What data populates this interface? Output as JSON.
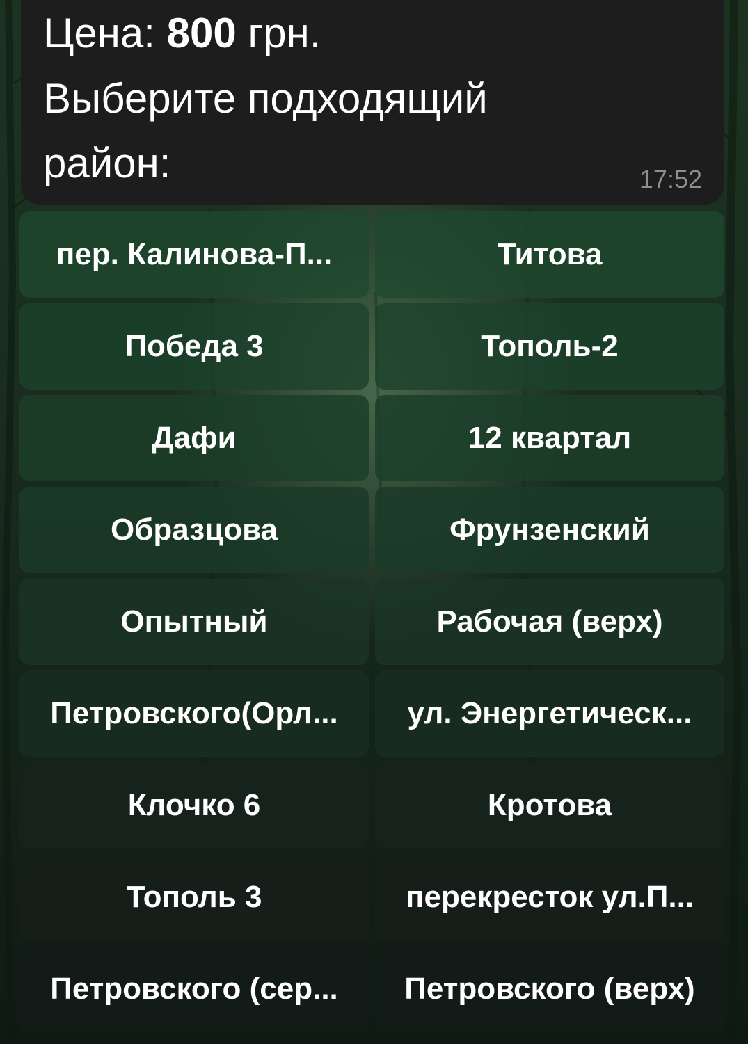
{
  "message": {
    "price_label": "Цена:",
    "price_value": "800",
    "price_currency": "грн.",
    "prompt_line1": "Выберите подходящий",
    "prompt_line2": "район:",
    "time": "17:52"
  },
  "keyboard": {
    "buttons": [
      "пер. Калинова-П...",
      "Титова",
      "Победа 3",
      "Тополь-2",
      "Дафи",
      "12 квартал",
      "Образцова",
      "Фрунзенский",
      "Опытный",
      "Рабочая (верх)",
      "Петровского(Орл...",
      "ул. Энергетическ...",
      "Клочко 6",
      "Кротова",
      "Тополь 3",
      "перекресток ул.П...",
      "Петровского (сер...",
      "Петровского (верх)"
    ]
  },
  "colors": {
    "bubble": "#1c1d1c",
    "button_bg": "#1c422c",
    "text": "#ffffff",
    "time_text": "#8e8f8e"
  }
}
